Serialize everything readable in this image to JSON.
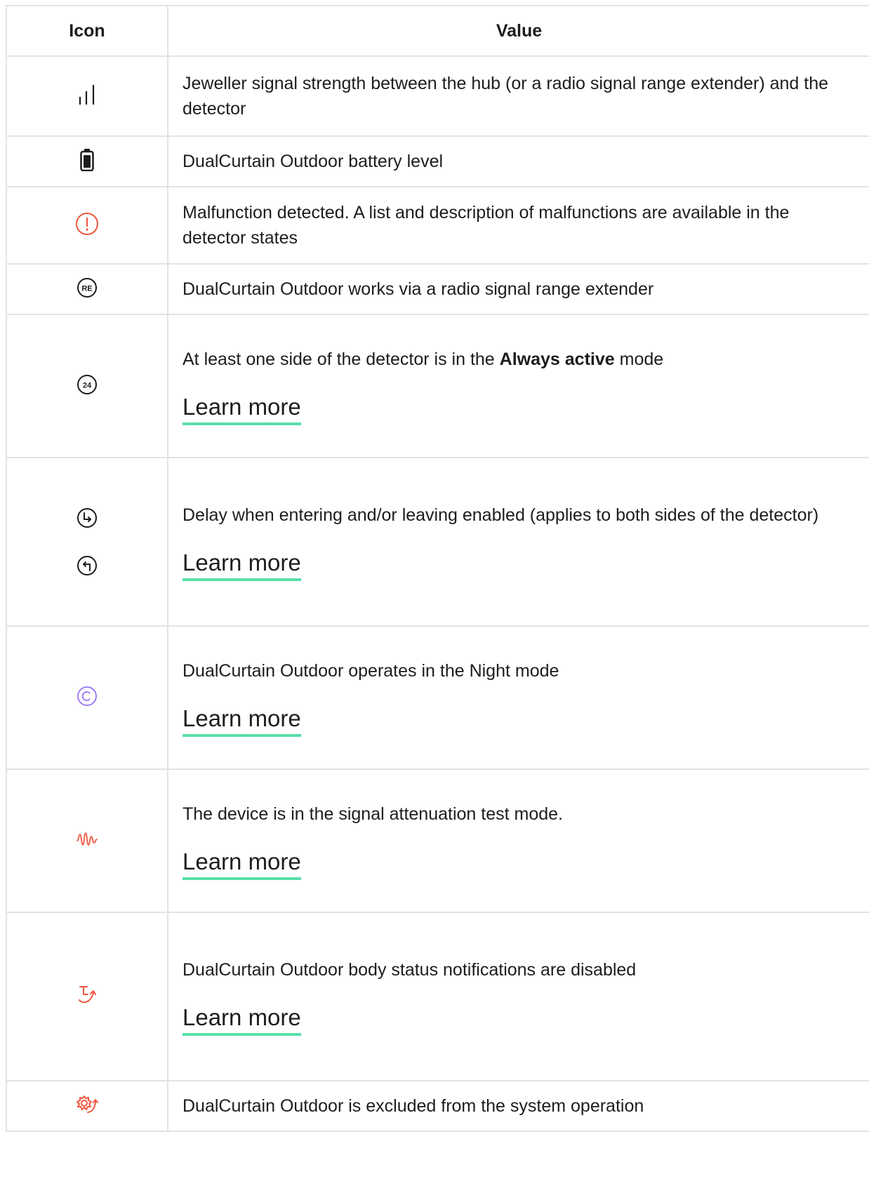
{
  "table": {
    "headers": {
      "icon": "Icon",
      "value": "Value"
    },
    "rows": [
      {
        "icon": "signal-strength-icon",
        "text": "Jeweller signal strength between the hub (or a radio signal range extender) and the detector"
      },
      {
        "icon": "battery-icon",
        "text": "DualCurtain Outdoor battery level"
      },
      {
        "icon": "malfunction-icon",
        "text": "Malfunction detected. A list and description of malfunctions are available in the detector states"
      },
      {
        "icon": "range-extender-icon",
        "icon_text": "RE",
        "text": "DualCurtain Outdoor works via a radio signal range extender"
      },
      {
        "icon": "always-active-icon",
        "icon_text": "24",
        "text_before": "At least one side of the detector is in the ",
        "text_bold": "Always active",
        "text_after": " mode",
        "link": "Learn more"
      },
      {
        "icon": "entry-exit-delay-icons",
        "text": "Delay when entering and/or leaving enabled (applies to both sides of the detector)",
        "link": "Learn more"
      },
      {
        "icon": "night-mode-icon",
        "text": "DualCurtain Outdoor operates in the Night mode",
        "link": "Learn more"
      },
      {
        "icon": "attenuation-test-icon",
        "text": "The device is in the signal attenuation test mode.",
        "link": "Learn more"
      },
      {
        "icon": "body-status-disabled-icon",
        "text": "DualCurtain Outdoor body status notifications are disabled",
        "link": "Learn more"
      },
      {
        "icon": "excluded-from-system-icon",
        "text": "DualCurtain Outdoor is excluded from the system operation"
      }
    ]
  },
  "colors": {
    "text": "#1d1d1f",
    "border": "#e3e3e3",
    "link_underline": "#58dfa9",
    "alert_red": "#f0573f",
    "night_purple": "#a07ef5"
  }
}
